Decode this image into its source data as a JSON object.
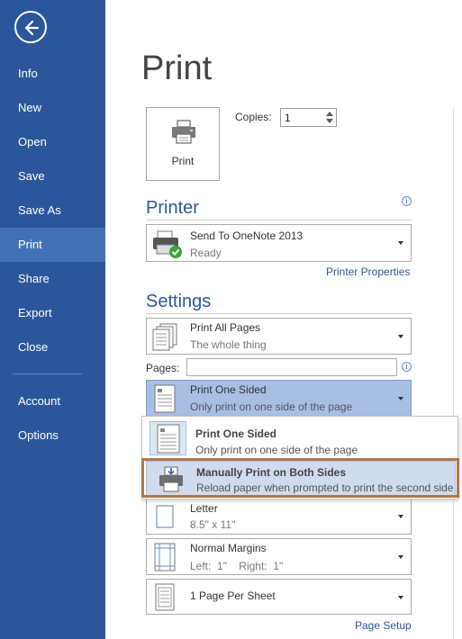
{
  "sidebar": {
    "items": [
      {
        "label": "Info"
      },
      {
        "label": "New"
      },
      {
        "label": "Open"
      },
      {
        "label": "Save"
      },
      {
        "label": "Save As"
      },
      {
        "label": "Print"
      },
      {
        "label": "Share"
      },
      {
        "label": "Export"
      },
      {
        "label": "Close"
      },
      {
        "label": "Account"
      },
      {
        "label": "Options"
      }
    ],
    "active": "Print"
  },
  "page": {
    "title": "Print"
  },
  "print_button": {
    "label": "Print"
  },
  "copies": {
    "label": "Copies:",
    "value": "1"
  },
  "printer": {
    "heading": "Printer",
    "name": "Send To OneNote 2013",
    "status": "Ready",
    "properties_link": "Printer Properties"
  },
  "settings": {
    "heading": "Settings",
    "pages_range": {
      "title": "Print All Pages",
      "subtitle": "The whole thing"
    },
    "pages_label": "Pages:",
    "pages_value": "",
    "sides": {
      "title": "Print One Sided",
      "subtitle": "Only print on one side of the page"
    },
    "paper": {
      "title": "Letter",
      "subtitle": "8.5\" x 11\""
    },
    "margins": {
      "title": "Normal Margins",
      "subtitle": "Left:  1\"    Right:  1\""
    },
    "per_sheet": {
      "title": "1 Page Per Sheet"
    },
    "page_setup_link": "Page Setup"
  },
  "sides_menu": {
    "options": [
      {
        "title": "Print One Sided",
        "subtitle": "Only print on one side of the page"
      },
      {
        "title": "Manually Print on Both Sides",
        "subtitle": "Reload paper when prompted to print the second side"
      }
    ]
  },
  "colors": {
    "sidebar": "#2b579a",
    "sidebar_active": "#4172b5",
    "accent": "#2b579a",
    "highlight": "#b07848"
  }
}
